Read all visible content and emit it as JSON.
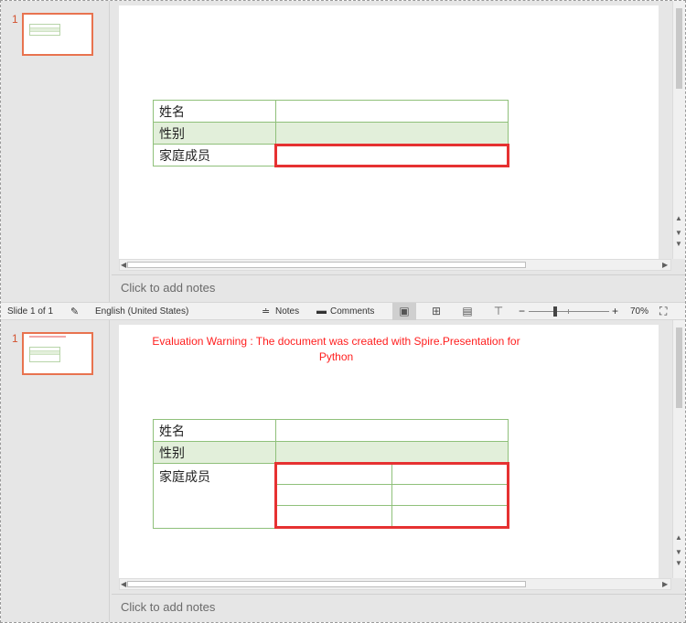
{
  "top": {
    "thumb_number": "1",
    "table_rows": [
      {
        "label": "姓名",
        "value": ""
      },
      {
        "label": "性别",
        "value": ""
      },
      {
        "label": "家庭成员",
        "value": ""
      }
    ],
    "notes_placeholder": "Click to add notes"
  },
  "statusbar": {
    "slide_info": "Slide 1 of 1",
    "language": "English (United States)",
    "notes_label": "Notes",
    "comments_label": "Comments",
    "zoom_minus": "−",
    "zoom_plus": "+",
    "zoom_level": "70%"
  },
  "bottom": {
    "thumb_number": "1",
    "warning_text": "Evaluation Warning : The document was created with Spire.Presentation for Python",
    "table_rows": [
      {
        "label": "姓名",
        "value": ""
      },
      {
        "label": "性别",
        "value": ""
      },
      {
        "label": "家庭成员",
        "value": ""
      }
    ],
    "notes_placeholder": "Click to add notes"
  },
  "colors": {
    "accent": "#e8734f",
    "highlight": "#e63131",
    "table_border": "#8fc07a",
    "table_band": "#e2efda",
    "warning": "#ff1e1e"
  }
}
